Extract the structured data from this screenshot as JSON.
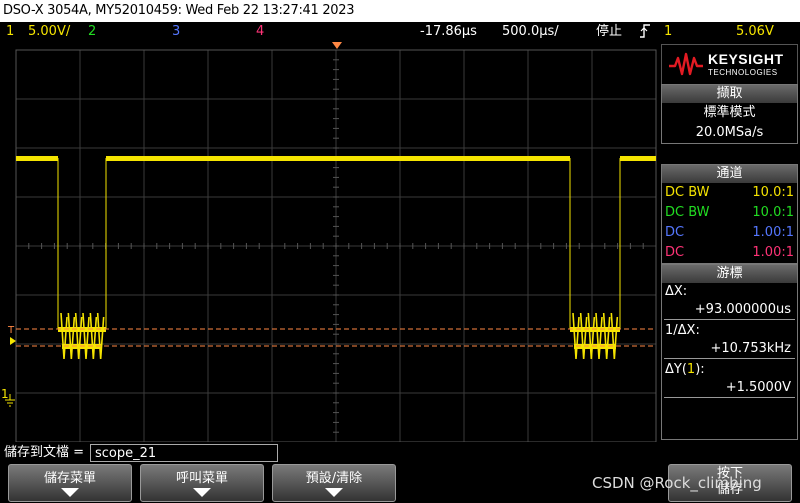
{
  "title": "DSO-X 3054A, MY52010459: Wed Feb 22 13:27:41 2023",
  "status": {
    "ch1_num": "1",
    "ch1_scale": "5.00V/",
    "ch2_num": "2",
    "ch3_num": "3",
    "ch4_num": "4",
    "delay": "-17.86µs",
    "timebase": "500.0µs/",
    "run_state": "停止",
    "trigger_icon": "trigger-edge-icon",
    "trig_ch": "1",
    "trig_level": "5.06V"
  },
  "colors": {
    "ch1": "#f5e400",
    "ch2": "#22dd22",
    "ch3": "#5577ff",
    "ch4": "#ff3377",
    "cursor": "#ff8844"
  },
  "side": {
    "logo_name": "KEYSIGHT",
    "logo_sub": "TECHNOLOGIES",
    "acquire": {
      "title": "擷取",
      "mode": "標準模式",
      "rate": "20.0MSa/s"
    },
    "channels": {
      "title": "通道",
      "rows": [
        {
          "label": "DC BW",
          "value": "10.0:1"
        },
        {
          "label": "DC BW",
          "value": "10.0:1"
        },
        {
          "label": "DC",
          "value": "1.00:1"
        },
        {
          "label": "DC",
          "value": "1.00:1"
        }
      ]
    },
    "cursors": {
      "title": "游標",
      "dx_label": "ΔX:",
      "dx_value": "+93.000000us",
      "inv_label": "1/ΔX:",
      "inv_value": "+10.753kHz",
      "dy_label_pre": "ΔY(",
      "dy_label_ch": "1",
      "dy_label_post": "):",
      "dy_value": "+1.5000V"
    }
  },
  "screen_markers": {
    "trigger_marker": "T",
    "ch1_marker": "1"
  },
  "bottom": {
    "file_label": "儲存到文檔 =",
    "file_value": "scope_21",
    "softkeys": [
      "儲存菜單",
      "呼叫菜單",
      "預設/清除",
      "按下"
    ],
    "softkey4_sub": "儲存"
  },
  "watermark": "CSDN @Rock_climbing"
}
